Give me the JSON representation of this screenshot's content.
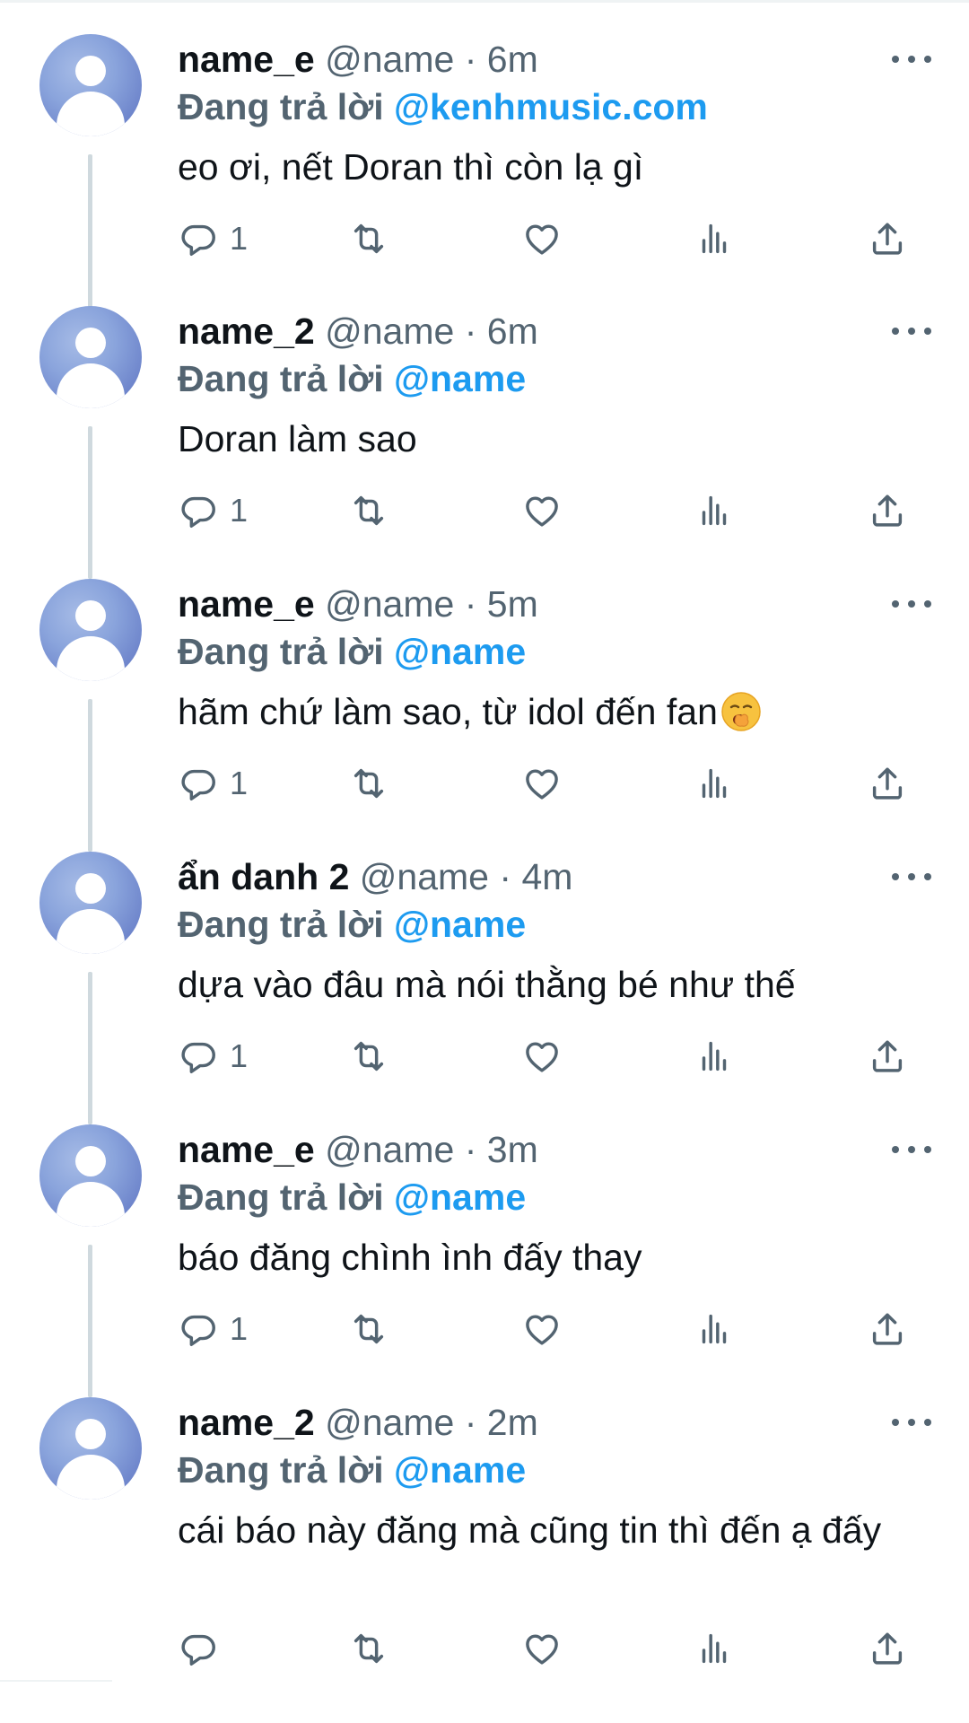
{
  "thread": [
    {
      "display_name": "name_e",
      "handle": "@name",
      "time": "6m",
      "reply_prefix": "Đang trả lời",
      "reply_to": "@kenhmusic.com",
      "text": "eo ơi, nết Doran thì còn lạ gì",
      "reply_count": "1"
    },
    {
      "display_name": "name_2",
      "handle": "@name",
      "time": "6m",
      "reply_prefix": "Đang trả lời",
      "reply_to": "@name",
      "text": "Doran làm sao",
      "reply_count": "1"
    },
    {
      "display_name": "name_e",
      "handle": "@name",
      "time": "5m",
      "reply_prefix": "Đang trả lời",
      "reply_to": "@name",
      "text": "hãm chứ làm sao, từ idol đến fan",
      "emoji": "yawning-face-emoji",
      "reply_count": "1"
    },
    {
      "display_name": "ẩn danh 2",
      "handle": "@name",
      "time": "4m",
      "reply_prefix": "Đang trả lời",
      "reply_to": "@name",
      "text": "dựa vào đâu mà nói thằng bé như thế",
      "reply_count": "1"
    },
    {
      "display_name": "name_e",
      "handle": "@name",
      "time": "3m",
      "reply_prefix": "Đang trả lời",
      "reply_to": "@name",
      "text": "báo đăng chình ình đấy thay",
      "reply_count": "1"
    },
    {
      "display_name": "name_2",
      "handle": "@name",
      "time": "2m",
      "reply_prefix": "Đang trả lời",
      "reply_to": "@name",
      "text": "cái báo này đăng mà cũng tin thì đến ạ đấy",
      "reply_count": ""
    }
  ],
  "separator": "·",
  "icons": {
    "avatar": "default-avatar-icon",
    "more": "more-options-icon",
    "reply": "reply-icon",
    "retweet": "retweet-icon",
    "like": "like-icon",
    "views": "views-icon",
    "share": "share-icon"
  },
  "colors": {
    "text": "#0f1419",
    "secondary": "#536471",
    "mention": "#1d9bf0",
    "avatar": "#7f97d6",
    "thread_line": "#cfd9de"
  }
}
